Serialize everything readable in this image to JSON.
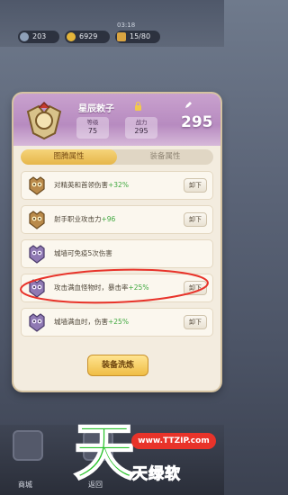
{
  "top_bar": {
    "timer": "03:18",
    "stone": "203",
    "gold": "6929",
    "energy": "15/80"
  },
  "hero": {
    "name": "星辰敕子",
    "level_label": "等级",
    "level": "75",
    "power_label": "战力",
    "power": "295",
    "total_power": "295"
  },
  "tabs": [
    {
      "label": "图腾属性",
      "active": true
    },
    {
      "label": "装备属性",
      "active": false
    }
  ],
  "attributes": [
    {
      "text": "对精英和首领伤害",
      "bonus": "+32%",
      "button": "卸下"
    },
    {
      "text": "射手职业攻击力",
      "bonus": "+96",
      "button": "卸下"
    },
    {
      "text": "城墙可免疫5次伤害",
      "bonus": "",
      "button": ""
    },
    {
      "text": "攻击满血怪物时，暴击率",
      "bonus": "+25%",
      "button": "卸下"
    },
    {
      "text": "城墙满血时，伤害",
      "bonus": "+25%",
      "button": "卸下"
    }
  ],
  "refine_button": "装备洗炼",
  "bottom_nav": {
    "shop": "商城",
    "back": "返回"
  },
  "watermark": {
    "big": "天",
    "url": "www.TTZIP.com",
    "text": "天绿软"
  },
  "colors": {
    "accent_gold": "#efbd45",
    "bonus_green": "#3fa83f",
    "header_purple": "#b78bc0",
    "annotation_red": "#e8332a"
  }
}
